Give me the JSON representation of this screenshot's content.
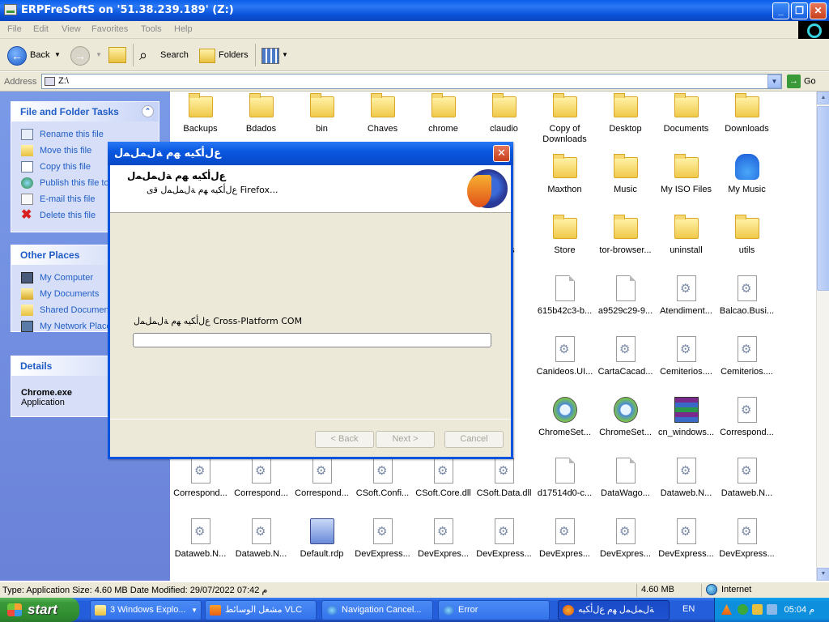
{
  "window": {
    "title": "ERPFreSoftS on '51.38.239.189' (Z:)"
  },
  "menu": [
    "File",
    "Edit",
    "View",
    "Favorites",
    "Tools",
    "Help"
  ],
  "toolbar": {
    "back": "Back",
    "search": "Search",
    "folders": "Folders"
  },
  "address": {
    "label": "Address",
    "value": "Z:\\",
    "go": "Go"
  },
  "tasks_panel": {
    "title": "File and Folder Tasks",
    "items": [
      "Rename this file",
      "Move this file",
      "Copy this file",
      "Publish this file to",
      "E-mail this file",
      "Delete this file"
    ]
  },
  "places_panel": {
    "title": "Other Places",
    "items": [
      "My Computer",
      "My Documents",
      "Shared Documents",
      "My Network Places"
    ]
  },
  "details_panel": {
    "title": "Details",
    "name": "Chrome.exe",
    "type": "Application"
  },
  "files": [
    {
      "name": "Backups",
      "icon": "folder"
    },
    {
      "name": "Bdados",
      "icon": "folder"
    },
    {
      "name": "bin",
      "icon": "folder"
    },
    {
      "name": "Chaves",
      "icon": "folder"
    },
    {
      "name": "chrome",
      "icon": "folder"
    },
    {
      "name": "claudio",
      "icon": "folder"
    },
    {
      "name": "Copy of Downloads",
      "icon": "folder"
    },
    {
      "name": "Desktop",
      "icon": "folder"
    },
    {
      "name": "Documents",
      "icon": "folder"
    },
    {
      "name": "Downloads",
      "icon": "folder"
    },
    {
      "name": "",
      "icon": "none"
    },
    {
      "name": "",
      "icon": "none"
    },
    {
      "name": "",
      "icon": "none"
    },
    {
      "name": "",
      "icon": "none"
    },
    {
      "name": "",
      "icon": "none"
    },
    {
      "name": "rvice",
      "icon": "none"
    },
    {
      "name": "Maxthon",
      "icon": "folder"
    },
    {
      "name": "Music",
      "icon": "folder"
    },
    {
      "name": "My ISO Files",
      "icon": "folder"
    },
    {
      "name": "My Music",
      "icon": "music"
    },
    {
      "name": "",
      "icon": "none"
    },
    {
      "name": "",
      "icon": "none"
    },
    {
      "name": "",
      "icon": "none"
    },
    {
      "name": "",
      "icon": "none"
    },
    {
      "name": "",
      "icon": "none"
    },
    {
      "name": "ugins",
      "icon": "none"
    },
    {
      "name": "Store",
      "icon": "folder"
    },
    {
      "name": "tor-browser...",
      "icon": "folder"
    },
    {
      "name": "uninstall",
      "icon": "folder"
    },
    {
      "name": "utils",
      "icon": "folder"
    },
    {
      "name": "",
      "icon": "none"
    },
    {
      "name": "",
      "icon": "none"
    },
    {
      "name": "",
      "icon": "none"
    },
    {
      "name": "",
      "icon": "none"
    },
    {
      "name": "",
      "icon": "none"
    },
    {
      "name": "3-b...",
      "icon": "none"
    },
    {
      "name": "615b42c3-b...",
      "icon": "doc"
    },
    {
      "name": "a9529c29-9...",
      "icon": "doc"
    },
    {
      "name": "Atendiment...",
      "icon": "dll"
    },
    {
      "name": "Balcao.Busi...",
      "icon": "dll"
    },
    {
      "name": "",
      "icon": "none"
    },
    {
      "name": "",
      "icon": "none"
    },
    {
      "name": "",
      "icon": "none"
    },
    {
      "name": "",
      "icon": "none"
    },
    {
      "name": "",
      "icon": "none"
    },
    {
      "name": ".D...",
      "icon": "none"
    },
    {
      "name": "Canideos.UI...",
      "icon": "dll"
    },
    {
      "name": "CartaCacad...",
      "icon": "dll"
    },
    {
      "name": "Cemiterios....",
      "icon": "dll"
    },
    {
      "name": "Cemiterios....",
      "icon": "dll"
    },
    {
      "name": "",
      "icon": "none"
    },
    {
      "name": "",
      "icon": "none"
    },
    {
      "name": "",
      "icon": "none"
    },
    {
      "name": "",
      "icon": "none"
    },
    {
      "name": "",
      "icon": "none"
    },
    {
      "name": "exe",
      "icon": "none"
    },
    {
      "name": "ChromeSet...",
      "icon": "setup"
    },
    {
      "name": "ChromeSet...",
      "icon": "setup"
    },
    {
      "name": "cn_windows...",
      "icon": "rar"
    },
    {
      "name": "Correspond...",
      "icon": "dll"
    },
    {
      "name": "Correspond...",
      "icon": "dll"
    },
    {
      "name": "Correspond...",
      "icon": "dll"
    },
    {
      "name": "Correspond...",
      "icon": "dll"
    },
    {
      "name": "CSoft.Confi...",
      "icon": "dll"
    },
    {
      "name": "CSoft.Core.dll",
      "icon": "dll"
    },
    {
      "name": "CSoft.Data.dll",
      "icon": "dll"
    },
    {
      "name": "d17514d0-c...",
      "icon": "doc"
    },
    {
      "name": "DataWago...",
      "icon": "doc"
    },
    {
      "name": "Dataweb.N...",
      "icon": "dll"
    },
    {
      "name": "Dataweb.N...",
      "icon": "dll"
    },
    {
      "name": "Dataweb.N...",
      "icon": "dll"
    },
    {
      "name": "Dataweb.N...",
      "icon": "dll"
    },
    {
      "name": "Default.rdp",
      "icon": "rdp"
    },
    {
      "name": "DevExpress...",
      "icon": "dll"
    },
    {
      "name": "DevExpres...",
      "icon": "dll"
    },
    {
      "name": "DevExpress...",
      "icon": "dll"
    },
    {
      "name": "DevExpres...",
      "icon": "dll"
    },
    {
      "name": "DevExpres...",
      "icon": "dll"
    },
    {
      "name": "DevExpress...",
      "icon": "dll"
    },
    {
      "name": "DevExpress...",
      "icon": "dll"
    }
  ],
  "dialog": {
    "title": "ﻉﻝﺃﻜﻴﻪ ﻬﻡ ﺔﻝﻤﻞﻤﻝ",
    "heading": "ﻉﻝﺃﻜﻴﻪ ﻬﻡ ﺔﻝﻤﻞﻤﻝ",
    "subheading": "ﻉﻝﺃﻜﻴﻪ ﻬﻡ ﺔﻝﻤﻞﻤﻝ ﻗﻯ Firefox...",
    "status": "ﻉﻝﺃﻜﻴﻪ ﻬﻡ ﺔﻝﻤﻞﻤﻝ Cross-Platform COM",
    "progress": 0,
    "back": "< Back",
    "next": "Next >",
    "cancel": "Cancel"
  },
  "statusbar": {
    "info": "Type: Application Size: 4.60 MB Date Modified: 29/07/2022 07:42 م",
    "size": "4.60 MB",
    "zone": "Internet"
  },
  "taskbar": {
    "start": "start",
    "tasks": [
      "3 Windows Explo...",
      "مشغل الوسائط VLC",
      "Navigation Cancel...",
      "Error",
      "ﺔﻝﻤﻞﻤﻝ ﻬﻡ ﻉﻝﺃﻜﻴﻪ"
    ],
    "lang": "EN",
    "clock": "05:04 م"
  }
}
